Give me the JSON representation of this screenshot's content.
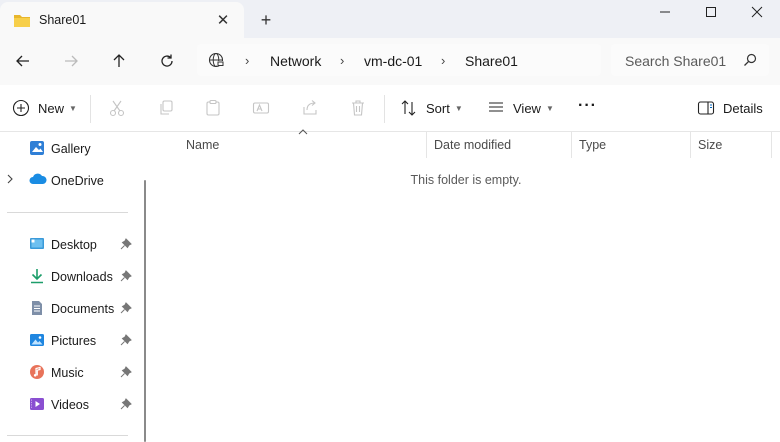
{
  "window": {
    "tab_title": "Share01",
    "tab_icon": "folder-icon",
    "new_tab_glyph": "+",
    "close_glyph": "✕"
  },
  "address": {
    "crumbs": [
      "Network",
      "vm-dc-01",
      "Share01"
    ],
    "separator": "›",
    "search_placeholder": "Search Share01"
  },
  "commands": {
    "new_label": "New",
    "sort_label": "Sort",
    "view_label": "View",
    "more_label": "···",
    "details_label": "Details"
  },
  "sidebar": {
    "top_items": [
      {
        "label": "Gallery",
        "icon": "gallery-icon"
      },
      {
        "label": "OneDrive",
        "icon": "onedrive-icon"
      }
    ],
    "pinned_items": [
      {
        "label": "Desktop",
        "icon": "desktop-icon"
      },
      {
        "label": "Downloads",
        "icon": "downloads-icon"
      },
      {
        "label": "Documents",
        "icon": "documents-icon"
      },
      {
        "label": "Pictures",
        "icon": "pictures-icon"
      },
      {
        "label": "Music",
        "icon": "music-icon"
      },
      {
        "label": "Videos",
        "icon": "videos-icon"
      }
    ]
  },
  "content": {
    "columns": [
      "Name",
      "Date modified",
      "Type",
      "Size"
    ],
    "empty_message": "This folder is empty."
  },
  "colors": {
    "accent": "#0067c0",
    "folder_yellow": "#f5c542",
    "titlebar_bg": "#eef0f5"
  }
}
